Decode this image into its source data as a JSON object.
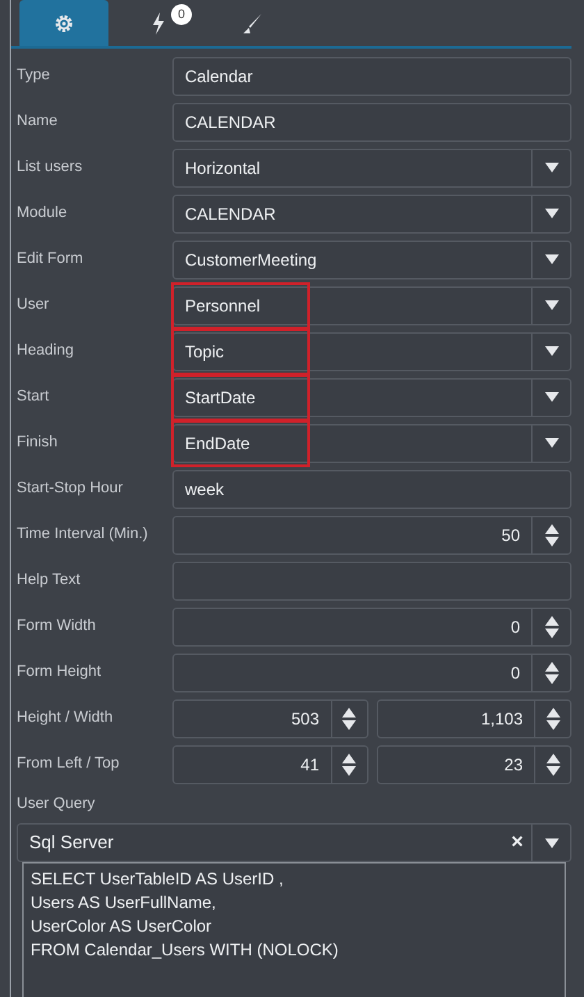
{
  "tabs": [
    {
      "kind": "gear",
      "selected": true
    },
    {
      "kind": "bolt",
      "badge": "0",
      "selected": false
    },
    {
      "kind": "brush",
      "selected": false
    }
  ],
  "fields": [
    {
      "kind": "text",
      "label": "Type",
      "value": "Calendar"
    },
    {
      "kind": "text",
      "label": "Name",
      "value": "CALENDAR"
    },
    {
      "kind": "select",
      "label": "List users",
      "value": "Horizontal",
      "highlighted": false
    },
    {
      "kind": "select",
      "label": "Module",
      "value": "CALENDAR",
      "highlighted": false
    },
    {
      "kind": "select",
      "label": "Edit Form",
      "value": "CustomerMeeting",
      "highlighted": false
    },
    {
      "kind": "select",
      "label": "User",
      "value": "Personnel",
      "highlighted": true
    },
    {
      "kind": "select",
      "label": "Heading",
      "value": "Topic",
      "highlighted": true
    },
    {
      "kind": "select",
      "label": "Start",
      "value": "StartDate",
      "highlighted": true
    },
    {
      "kind": "select",
      "label": "Finish",
      "value": "EndDate",
      "highlighted": true
    },
    {
      "kind": "text",
      "label": "Start-Stop Hour",
      "value": "week"
    },
    {
      "kind": "number",
      "label": "Time Interval (Min.)",
      "value": "50"
    },
    {
      "kind": "text",
      "label": "Help Text"
    },
    {
      "kind": "number",
      "label": "Form Width",
      "value": "0"
    },
    {
      "kind": "number",
      "label": "Form Height",
      "value": "0"
    },
    {
      "kind": "pair",
      "label": "Height / Width",
      "values": [
        "503",
        "1,103"
      ]
    },
    {
      "kind": "pair",
      "label": "From Left / Top",
      "values": [
        "41",
        "23"
      ]
    }
  ],
  "user_query": {
    "label": "User Query",
    "dialect": "Sql Server",
    "clear": "×",
    "query": "SELECT UserTableID AS UserID ,\nUsers AS UserFullName,\nUserColor AS UserColor\nFROM Calendar_Users WITH (NOLOCK)"
  }
}
